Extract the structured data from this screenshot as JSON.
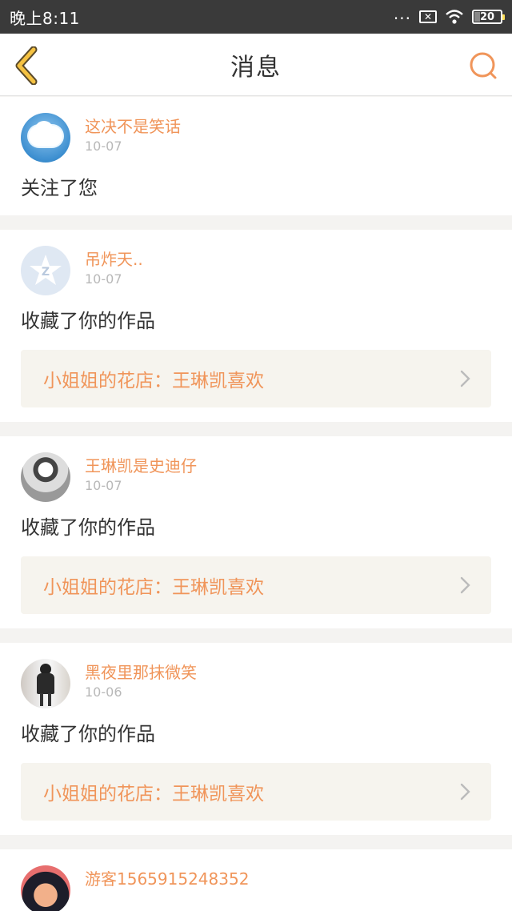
{
  "statusbar": {
    "time": "晚上8:11",
    "battery": "20"
  },
  "header": {
    "title": "消息"
  },
  "messages": [
    {
      "username": "这决不是笑话",
      "date": "10-07",
      "action": "关注了您",
      "avatar": "cloud-avatar"
    },
    {
      "username": "吊炸天..",
      "date": "10-07",
      "action": "收藏了你的作品",
      "work": "小姐姐的花店：王琳凯喜欢",
      "avatar": "qzone-avatar"
    },
    {
      "username": "王琳凯是史迪仔",
      "date": "10-07",
      "action": "收藏了你的作品",
      "work": "小姐姐的花店：王琳凯喜欢",
      "avatar": "photo-avatar"
    },
    {
      "username": "黑夜里那抹微笑",
      "date": "10-06",
      "action": "收藏了你的作品",
      "work": "小姐姐的花店：王琳凯喜欢",
      "avatar": "photo-avatar"
    },
    {
      "username": "游客1565915248352",
      "avatar": "photo-avatar"
    }
  ],
  "colors": {
    "accent": "#f0955a",
    "back_icon": "#f5c242",
    "link_bg": "#f6f4ee"
  },
  "icons": [
    "back-chevron-icon",
    "search-icon",
    "chevron-right-icon",
    "wifi-icon",
    "sim-icon",
    "battery-icon"
  ]
}
